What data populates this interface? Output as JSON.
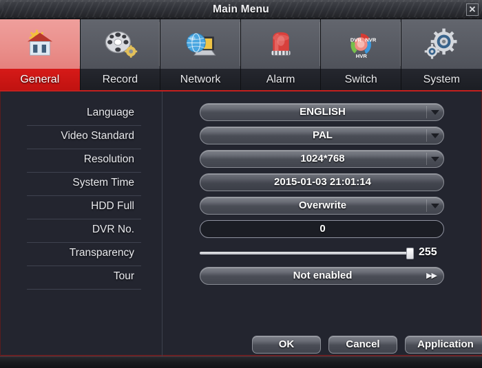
{
  "window": {
    "title": "Main Menu",
    "close_label": "✕",
    "accent_red": "#c4201e",
    "panel_bg": "#23252f"
  },
  "tabs": [
    {
      "label": "General",
      "icon": "house-gear-icon",
      "active": true
    },
    {
      "label": "Record",
      "icon": "film-reel-gear-icon",
      "active": false
    },
    {
      "label": "Network",
      "icon": "globe-laptop-icon",
      "active": false
    },
    {
      "label": "Alarm",
      "icon": "alarm-siren-icon",
      "active": false
    },
    {
      "label": "Switch",
      "icon": "dvr-nvr-hvr-switch-icon",
      "active": false
    },
    {
      "label": "System",
      "icon": "gears-icon",
      "active": false
    }
  ],
  "switch_icon_text": {
    "dvr": "DVR",
    "nvr": "NVR",
    "hvr": "HVR"
  },
  "settings": {
    "rows": [
      {
        "label": "Language",
        "value": "ENGLISH",
        "control": "dropdown"
      },
      {
        "label": "Video Standard",
        "value": "PAL",
        "control": "dropdown"
      },
      {
        "label": "Resolution",
        "value": "1024*768",
        "control": "dropdown"
      },
      {
        "label": "System Time",
        "value": "2015-01-03 21:01:14",
        "control": "field"
      },
      {
        "label": "HDD Full",
        "value": "Overwrite",
        "control": "dropdown"
      },
      {
        "label": "DVR No.",
        "value": "0",
        "control": "input"
      },
      {
        "label": "Transparency",
        "value": "255",
        "control": "slider"
      },
      {
        "label": "Tour",
        "value": "Not enabled",
        "control": "button"
      }
    ]
  },
  "slider": {
    "value": "255",
    "min": 0,
    "max": 255,
    "percent": 100
  },
  "tour": {
    "more_glyph": "▶▶"
  },
  "footer": {
    "ok": "OK",
    "cancel": "Cancel",
    "application": "Application"
  }
}
